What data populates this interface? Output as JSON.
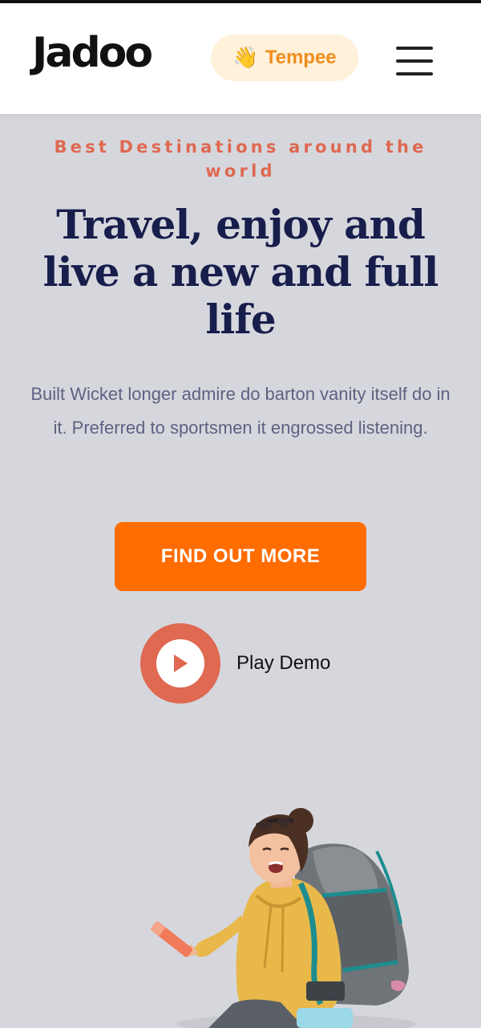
{
  "header": {
    "logo": "Jadoo",
    "language": {
      "emoji": "👋",
      "label": "Tempee"
    },
    "menu_icon": "hamburger-menu-icon"
  },
  "hero": {
    "eyebrow": "Best Destinations around the world",
    "headline": "Travel, enjoy and live a new and full life",
    "description": "Built Wicket longer admire do barton vanity itself do in it. Preferred to sportsmen it engrossed listening.",
    "cta_label": "FIND OUT MORE",
    "play_label": "Play Demo"
  },
  "colors": {
    "background": "#d6d7dd",
    "accent_orange": "#ff6c00",
    "accent_coral": "#df6951",
    "heading_navy": "#181e4b",
    "body_text": "#5e6282",
    "pill_bg": "#fff1da"
  }
}
